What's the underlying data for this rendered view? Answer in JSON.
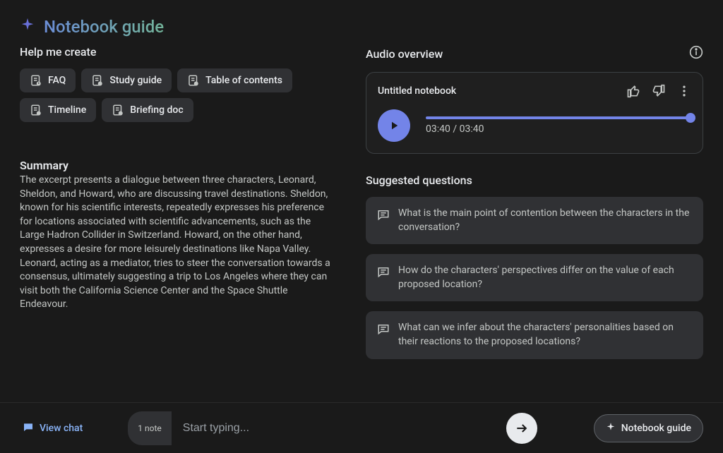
{
  "header": {
    "title": "Notebook guide"
  },
  "left": {
    "help_create": "Help me create",
    "chips": [
      {
        "label": "FAQ"
      },
      {
        "label": "Study guide"
      },
      {
        "label": "Table of contents"
      },
      {
        "label": "Timeline"
      },
      {
        "label": "Briefing doc"
      }
    ],
    "summary_heading": "Summary",
    "summary_text": "The excerpt presents a dialogue between three characters, Leonard, Sheldon, and Howard, who are discussing travel destinations. Sheldon, known for his scientific interests, repeatedly expresses his preference for locations associated with scientific advancements, such as the Large Hadron Collider in Switzerland. Howard, on the other hand, expresses a desire for more leisurely destinations like Napa Valley. Leonard, acting as a mediator, tries to steer the conversation towards a consensus, ultimately suggesting a trip to Los Angeles where they can visit both the California Science Center and the Space Shuttle Endeavour."
  },
  "right": {
    "audio_overview": "Audio overview",
    "audio_title": "Untitled notebook",
    "time": "03:40 / 03:40",
    "suggested_heading": "Suggested questions",
    "questions": [
      "What is the main point of contention between the characters in the conversation?",
      "How do the characters' perspectives differ on the value of each proposed location?",
      "What can we infer about the characters' personalities based on their reactions to the proposed locations?"
    ]
  },
  "bottom": {
    "view_chat": "View chat",
    "notes_badge": "1 note",
    "placeholder": "Start typing...",
    "notebook_guide": "Notebook guide"
  }
}
